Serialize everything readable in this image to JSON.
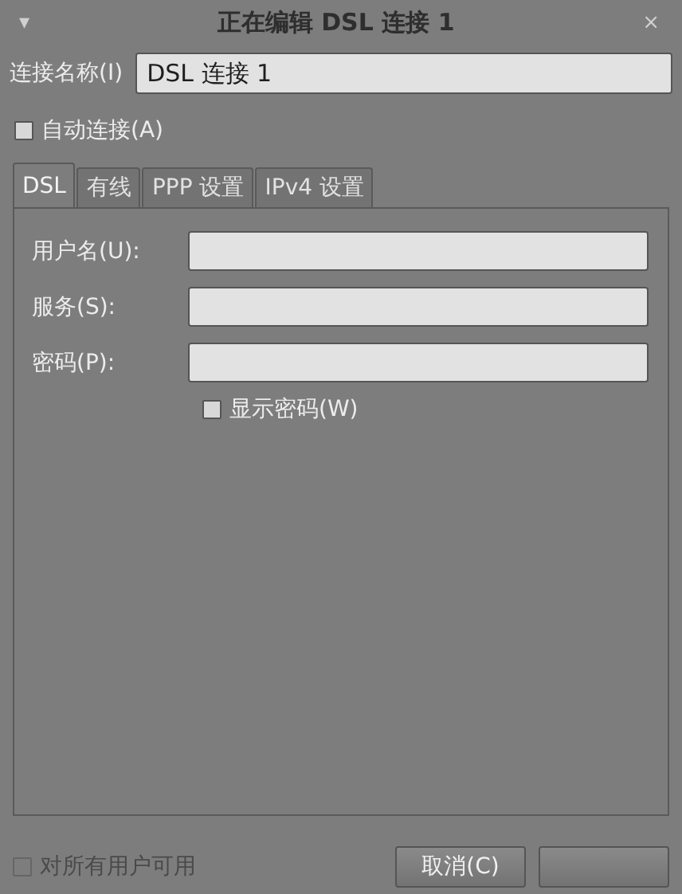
{
  "window": {
    "title": "正在编辑 DSL 连接 1",
    "menu_glyph": "▾",
    "close_glyph": "×"
  },
  "connection_name": {
    "label": "连接名称(I)",
    "value": "DSL 连接 1"
  },
  "auto_connect": {
    "label": "自动连接(A)",
    "checked": false
  },
  "tabs": [
    {
      "label": "DSL",
      "selected": true
    },
    {
      "label": "有线",
      "selected": false
    },
    {
      "label": "PPP 设置",
      "selected": false
    },
    {
      "label": "IPv4 设置",
      "selected": false
    }
  ],
  "fields": [
    {
      "label": "用户名(U):"
    },
    {
      "label": "服务(S):"
    },
    {
      "label": "密码(P):"
    }
  ],
  "show_password": {
    "label": "显示密码(W)",
    "checked": false
  },
  "all_users": {
    "label": "对所有用户可用",
    "checked": false,
    "disabled": true
  },
  "buttons": [
    {
      "kind": "button",
      "label": "取消(C)"
    },
    {
      "kind": "button"
    }
  ]
}
